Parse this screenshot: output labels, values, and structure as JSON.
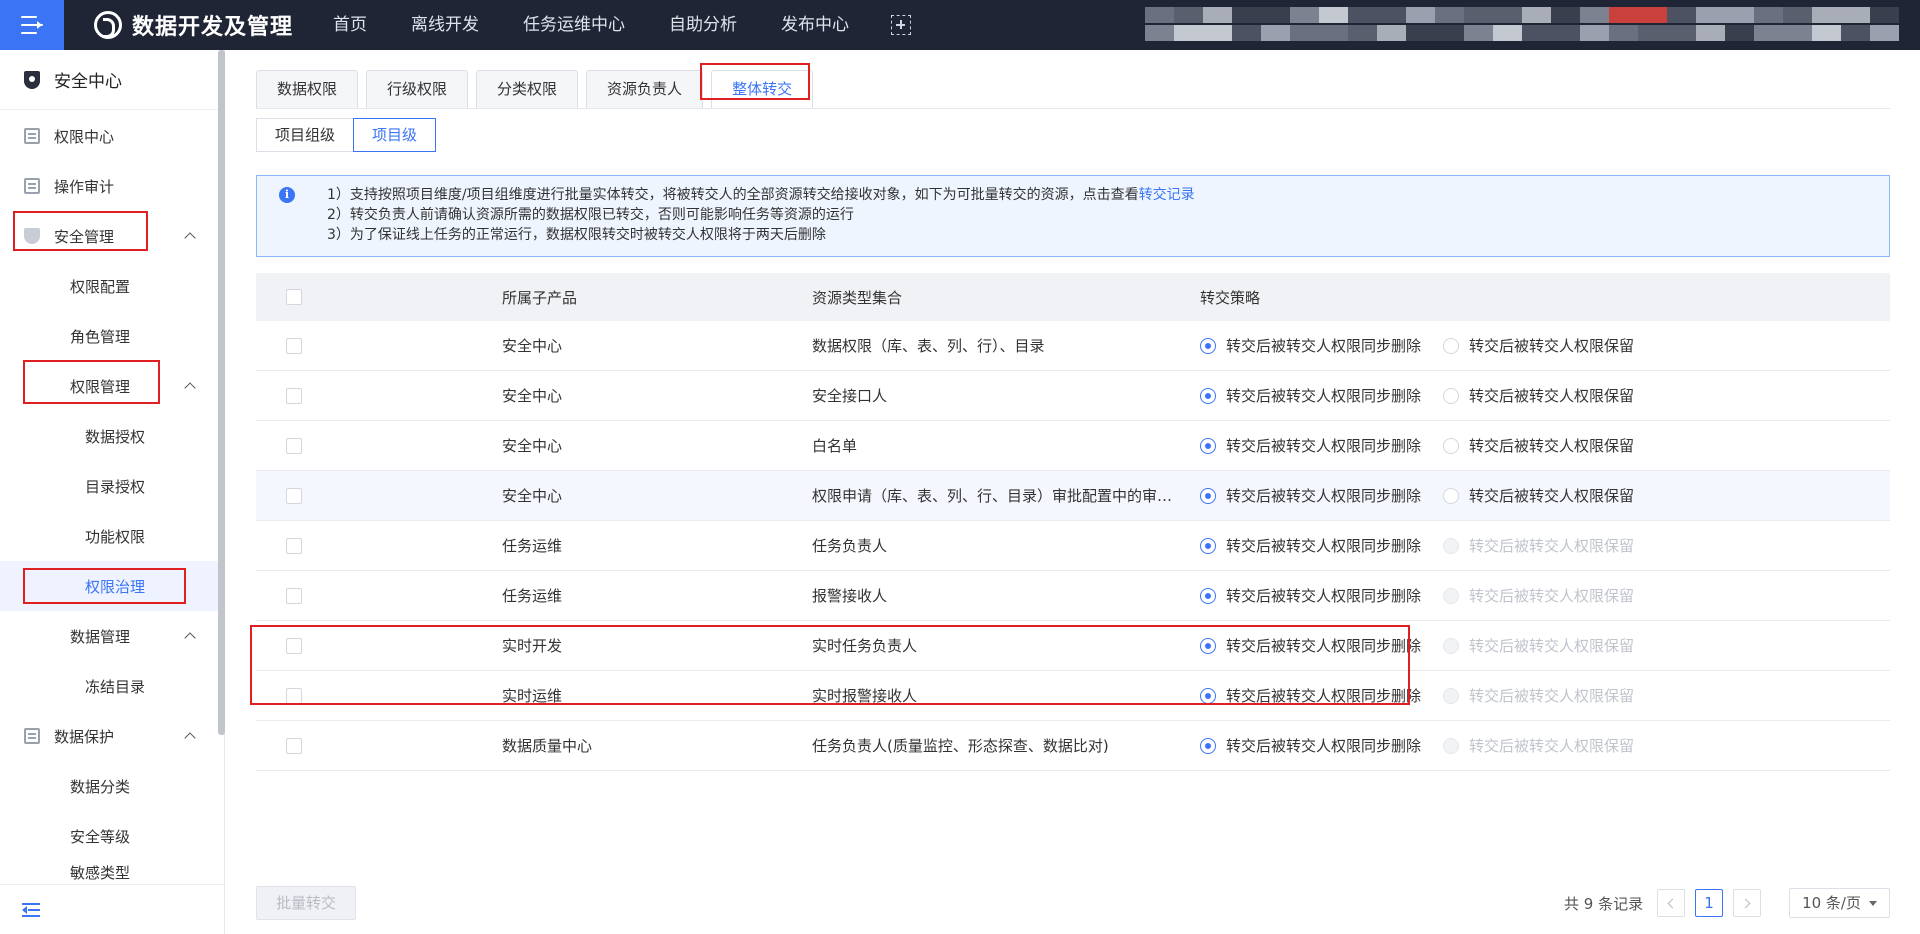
{
  "topbar": {
    "brand": "数据开发及管理",
    "nav": [
      "首页",
      "离线开发",
      "任务运维中心",
      "自助分析",
      "发布中心"
    ]
  },
  "sidebar": {
    "title": "安全中心",
    "items": [
      {
        "label": "权限中心"
      },
      {
        "label": "操作审计"
      },
      {
        "label": "安全管理"
      },
      {
        "label": "权限配置"
      },
      {
        "label": "角色管理"
      },
      {
        "label": "权限管理"
      },
      {
        "label": "数据授权"
      },
      {
        "label": "目录授权"
      },
      {
        "label": "功能权限"
      },
      {
        "label": "权限治理"
      },
      {
        "label": "数据管理"
      },
      {
        "label": "冻结目录"
      },
      {
        "label": "数据保护"
      },
      {
        "label": "数据分类"
      },
      {
        "label": "安全等级"
      },
      {
        "label": "敏感类型"
      }
    ]
  },
  "tabs": [
    "数据权限",
    "行级权限",
    "分类权限",
    "资源负责人",
    "整体转交"
  ],
  "subtabs": [
    "项目组级",
    "项目级"
  ],
  "alert": {
    "line1": "1）支持按照项目维度/项目组维度进行批量实体转交，将被转交人的全部资源转交给接收对象，如下为可批量转交的资源，点击查看",
    "line1_link": "转交记录",
    "line2": "2）转交负责人前请确认资源所需的数据权限已转交，否则可能影响任务等资源的运行",
    "line3": "3）为了保证线上任务的正常运行，数据权限转交时被转交人权限将于两天后删除"
  },
  "table": {
    "headers": [
      "所属子产品",
      "资源类型集合",
      "转交策略"
    ],
    "option_delete": "转交后被转交人权限同步删除",
    "option_keep": "转交后被转交人权限保留",
    "rows": [
      {
        "product": "安全中心",
        "resource": "数据权限（库、表、列、行）、目录"
      },
      {
        "product": "安全中心",
        "resource": "安全接口人"
      },
      {
        "product": "安全中心",
        "resource": "白名单"
      },
      {
        "product": "安全中心",
        "resource": "权限申请（库、表、列、行、目录）审批配置中的审批人"
      },
      {
        "product": "任务运维",
        "resource": "任务负责人"
      },
      {
        "product": "任务运维",
        "resource": "报警接收人"
      },
      {
        "product": "实时开发",
        "resource": "实时任务负责人"
      },
      {
        "product": "实时运维",
        "resource": "实时报警接收人"
      },
      {
        "product": "数据质量中心",
        "resource": "任务负责人(质量监控、形态探查、数据比对)"
      }
    ]
  },
  "footer": {
    "batch_button": "批量转交",
    "total": "共 9 条记录",
    "page": "1",
    "page_size": "10 条/页"
  }
}
